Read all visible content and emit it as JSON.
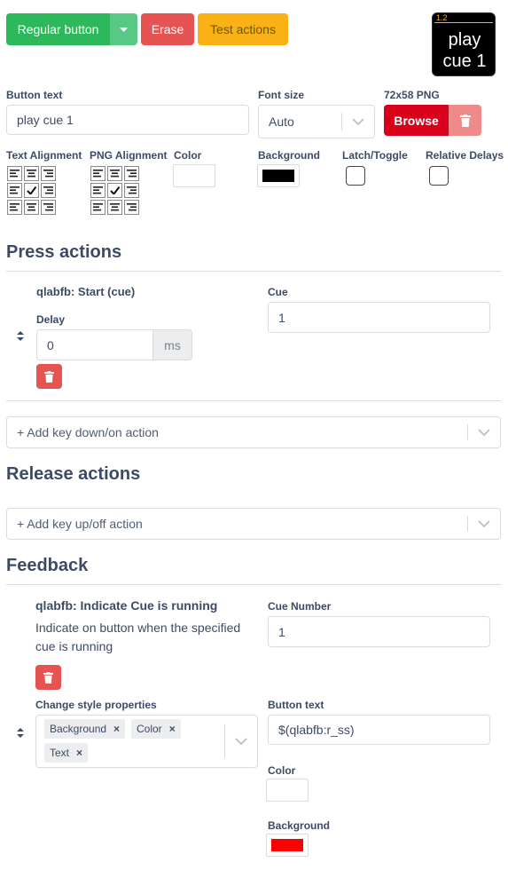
{
  "toolbar": {
    "style_button": "Regular button",
    "erase": "Erase",
    "test_actions": "Test actions"
  },
  "preview": {
    "page_label": "1.2",
    "text": "play\ncue 1"
  },
  "button_text": {
    "label": "Button text",
    "value": "play cue 1"
  },
  "font_size": {
    "label": "Font size",
    "value": "Auto"
  },
  "png": {
    "label": "72x58 PNG",
    "browse": "Browse"
  },
  "text_alignment": {
    "label": "Text Alignment"
  },
  "png_alignment": {
    "label": "PNG Alignment"
  },
  "color": {
    "label": "Color",
    "value": "#ffffff"
  },
  "background": {
    "label": "Background",
    "value": "#000000"
  },
  "latch": {
    "label": "Latch/Toggle"
  },
  "relative_delays": {
    "label": "Relative Delays"
  },
  "press_actions": {
    "title": "Press actions",
    "actions": [
      {
        "name": "qlabfb: Start (cue)",
        "delay_label": "Delay",
        "delay_value": "0",
        "delay_unit": "ms",
        "cue_label": "Cue",
        "cue_value": "1"
      }
    ],
    "add_placeholder": "+ Add key down/on action"
  },
  "release_actions": {
    "title": "Release actions",
    "add_placeholder": "+ Add key up/off action"
  },
  "feedback": {
    "title": "Feedback",
    "items": [
      {
        "name": "qlabfb: Indicate Cue is running",
        "description": "Indicate on button when the specified cue is running",
        "cue_number_label": "Cue Number",
        "cue_number_value": "1",
        "style_props_label": "Change style properties",
        "style_props": [
          "Background",
          "Color",
          "Text"
        ],
        "button_text_label": "Button text",
        "button_text_value": "$(qlabfb:r_ss)",
        "color_label": "Color",
        "color_value": "#ffffff",
        "background_label": "Background",
        "background_value": "#ff0000"
      }
    ]
  },
  "colors": {
    "success": "#2eb85c",
    "danger": "#e55353",
    "danger_dark": "#d9001b",
    "warning": "#f9b115",
    "text": "#3c4b64"
  }
}
